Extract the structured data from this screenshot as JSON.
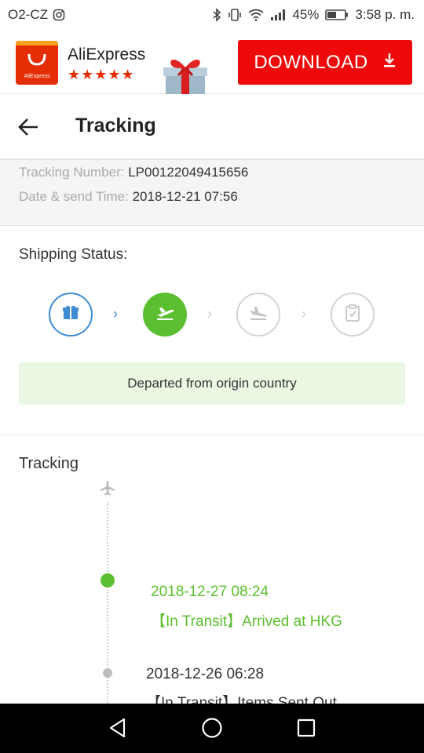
{
  "status_bar": {
    "carrier": "O2-CZ",
    "battery": "45%",
    "time": "3:58 p. m."
  },
  "banner": {
    "app_name": "AliExpress",
    "logo_text": "AliExpress",
    "rating": "★★★★★",
    "download_label": "DOWNLOAD"
  },
  "header": {
    "title": "Tracking"
  },
  "info": {
    "tracking_number_label": "Tracking Number:",
    "tracking_number": "LP00122049415656",
    "date_label": "Date & send Time:",
    "date_value": "2018-12-21 07:56"
  },
  "shipping": {
    "title": "Shipping Status:",
    "current_status": "Departed from origin country",
    "accent_blue": "#3d8bd4",
    "accent_green": "#5cbf31"
  },
  "tracking": {
    "title": "Tracking",
    "events": [
      {
        "time": "2018-12-27 08:24",
        "desc": "【In Transit】Arrived at HKG"
      },
      {
        "time": "2018-12-26 06:28",
        "desc": "【In Transit】Items Sent Out"
      }
    ]
  },
  "icons": {
    "status_bar": [
      "instagram-icon",
      "bluetooth-icon",
      "vibrate-icon",
      "wifi-icon",
      "signal-icon",
      "battery-icon"
    ],
    "steps": [
      "package-icon",
      "plane-takeoff-icon",
      "plane-landing-icon",
      "clipboard-check-icon"
    ],
    "nav": [
      "back-triangle-icon",
      "home-circle-icon",
      "recents-square-icon"
    ]
  }
}
